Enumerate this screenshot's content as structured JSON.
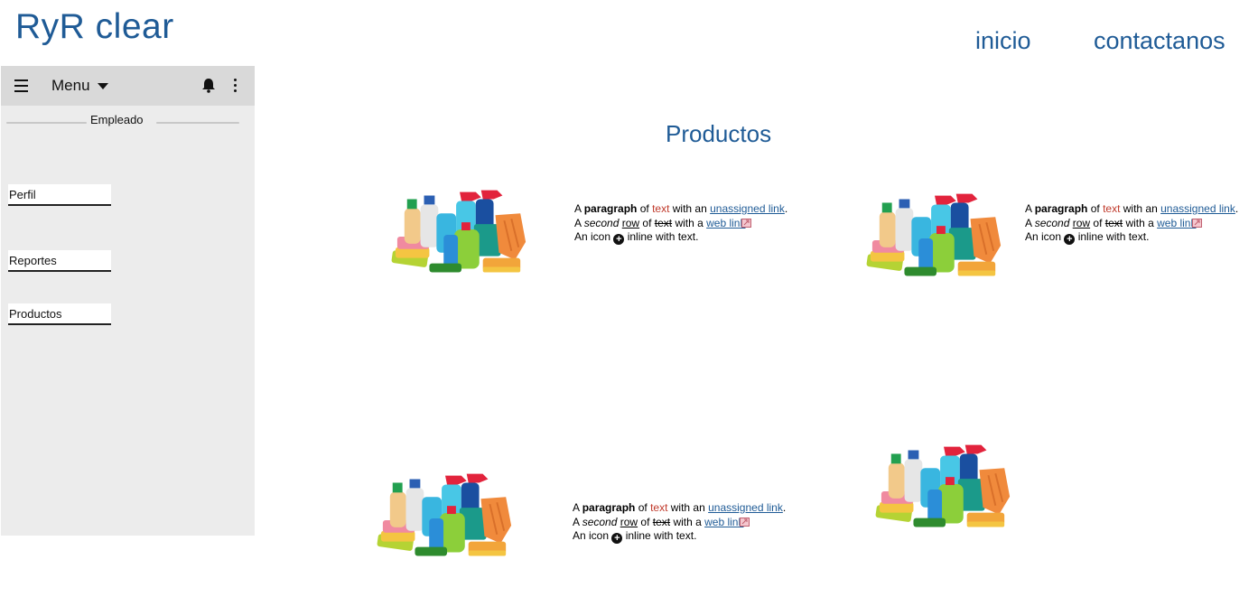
{
  "header": {
    "brand": "RyR clear",
    "nav": [
      {
        "label": "inicio"
      },
      {
        "label": "contactanos"
      }
    ]
  },
  "sidebar": {
    "menu_label": "Menu",
    "section_label": "Empleado",
    "items": [
      {
        "label": "Perfil"
      },
      {
        "label": "Reportes"
      },
      {
        "label": "Productos"
      }
    ],
    "icons": [
      "hamburger-icon",
      "chevron-down-icon",
      "bell-icon",
      "kebab-icon"
    ]
  },
  "main": {
    "title": "Productos",
    "card_text": {
      "p1_a": "A ",
      "p1_bold": "paragraph",
      "p1_b": " of ",
      "p1_red": "text",
      "p1_c": " with an ",
      "p1_link": "unassigned link",
      "p1_d": ".",
      "p2_a": "A ",
      "p2_italic": "second",
      "p2_b": " ",
      "p2_u": "row",
      "p2_c": " of ",
      "p2_strike": "text",
      "p2_d": " with a ",
      "p2_link": "web link",
      "p3_a": "An icon ",
      "p3_icon": "+",
      "p3_b": " inline with text."
    }
  },
  "colors": {
    "brand": "#1f5b96",
    "sidebar_bg": "#ececec",
    "sidebar_header_bg": "#d9d9d9",
    "red_text": "#c0392b"
  }
}
